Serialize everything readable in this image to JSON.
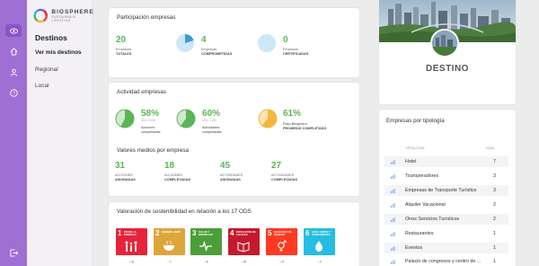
{
  "brand": {
    "name": "BIOSPHERE",
    "tagline": "SUSTAINABLE LIFESTYLE"
  },
  "rail": {
    "items": [
      "eye-icon",
      "home-icon",
      "user-icon",
      "help-icon"
    ],
    "bottom": "logout-icon",
    "active_color": "#8a55c6",
    "bg_color": "#a06fd3"
  },
  "sidebar": {
    "title": "Destinos",
    "items": [
      "Ver mis destinos",
      "Regional",
      "Local"
    ]
  },
  "participacion": {
    "title": "Participación empresas",
    "stats": [
      {
        "value": "20",
        "label1": "Empresas",
        "label2": "TOTALES",
        "pie": null
      },
      {
        "value": "4",
        "label1": "Empresas",
        "label2": "COMPROMETIDAS",
        "pie": 0.2
      },
      {
        "value": "0",
        "label1": "Empresas",
        "label2": "CERTIFICADAS",
        "pie": 0
      }
    ]
  },
  "actividad": {
    "title": "Actividad empresas",
    "stats": [
      {
        "value": "58%",
        "detail": "353 / 608",
        "label1": "Acciones",
        "label2": "completadas",
        "pie": 0.58,
        "color": "#5bb557"
      },
      {
        "value": "60%",
        "detail": "204 / 340",
        "label1": "Actividades",
        "label2": "completadas",
        "pie": 0.6,
        "color": "#5bb557"
      },
      {
        "value": "61%",
        "detail": "",
        "label1": "Paso Biosphere",
        "label2": "PROMEDIO COMPLETADO",
        "pie": 0.61,
        "color": "#f3b63f"
      }
    ],
    "medios_title": "Valores medios por empresa",
    "medios": [
      {
        "value": "31",
        "label1": "ACCIONES",
        "label2": "ASIGNADAS"
      },
      {
        "value": "18",
        "label1": "ACCIONES",
        "label2": "COMPLETADAS"
      },
      {
        "value": "45",
        "label1": "ACTIVIDADES",
        "label2": "ASIGNADAS"
      },
      {
        "value": "27",
        "label1": "ACTIVIDADES",
        "label2": "COMPLETADAS"
      }
    ]
  },
  "ods": {
    "title": "Valoración de sostenibilidad en relación a los 17 ODS",
    "tiles": [
      {
        "n": "1",
        "text": "FIN DE LA POBREZA",
        "color": "#e5243b",
        "icon": "family-icon"
      },
      {
        "n": "2",
        "text": "HAMBRE CERO",
        "color": "#dda63a",
        "icon": "bowl-icon"
      },
      {
        "n": "3",
        "text": "SALUD Y BIENESTAR",
        "color": "#4c9f38",
        "icon": "heartbeat-icon"
      },
      {
        "n": "4",
        "text": "EDUCACIÓN DE CALIDAD",
        "color": "#c5192d",
        "icon": "book-icon"
      },
      {
        "n": "5",
        "text": "IGUALDAD DE GÉNERO",
        "color": "#ff3a21",
        "icon": "gender-icon"
      },
      {
        "n": "6",
        "text": "AGUA LIMPIA Y SANEAMIENTO",
        "color": "#26bde2",
        "icon": "water-icon"
      }
    ]
  },
  "destino": {
    "label": "DESTINO"
  },
  "tipologia": {
    "title": "Empresas por tipología",
    "col_name": "TIPOLOGÍA",
    "col_num": "NÚM.",
    "rows": [
      {
        "name": "Hotel",
        "value": "7"
      },
      {
        "name": "Touroperadores",
        "value": "3"
      },
      {
        "name": "Empresas de Transporte Turístico",
        "value": "3"
      },
      {
        "name": "Alquiler Vacacional",
        "value": "2"
      },
      {
        "name": "Otros Servicios Turísticos",
        "value": "2"
      },
      {
        "name": "Restaurantes",
        "value": "1"
      },
      {
        "name": "Eventos",
        "value": "1"
      },
      {
        "name": "Palacio de congresos y centro de ...",
        "value": "1"
      }
    ]
  }
}
